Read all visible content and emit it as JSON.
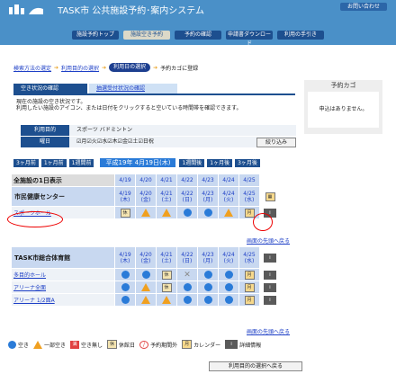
{
  "header": {
    "title": "TASK市 公共施設予約･案内システム",
    "help": "お問い合わせ",
    "nav": [
      "施設予約トップ",
      "施設空き予約",
      "予約の確認",
      "申請書ダウンロード",
      "利用の手引き"
    ],
    "active_nav": 1
  },
  "steps": {
    "s1": "検索方法の選定",
    "s2": "利用目的の選択",
    "s3": "利用日の選択",
    "s4": "予約カゴに登録"
  },
  "tabs": {
    "t1": "空き状況の確認",
    "t2": "抽選受付状況の確認"
  },
  "notice": {
    "line1": "現在の施設の空き状況です。",
    "line2": "利用したい施設のアイコン、または日付をクリックすると空いている時間帯を確認できます。"
  },
  "filter": {
    "purpose_label": "利用目的",
    "purpose_value": "スポーツ バドミントン",
    "day_label": "曜日",
    "days": [
      "月",
      "火",
      "水",
      "木",
      "金",
      "土",
      "日祝"
    ],
    "narrow_button": "絞り込み"
  },
  "side": {
    "title": "予約カゴ",
    "body": "申込はありません。"
  },
  "datenav": {
    "prev3": "3ヶ月前",
    "prev1": "1ヶ月前",
    "prevw": "1週間前",
    "current": "平成19年 4月19日(木)",
    "nextw": "1週間後",
    "next1": "1ヶ月後",
    "next3": "3ヶ月後"
  },
  "section_all": "全施設の1日表示",
  "center1": {
    "name": "市民健康センター",
    "facilities": [
      {
        "name": "スポーツホール",
        "cells": [
          "rest",
          "few",
          "few",
          "open",
          "open",
          "few",
          "cal",
          "info"
        ]
      }
    ],
    "back": "画面の先頭へ戻る"
  },
  "center2": {
    "name": "TASK市総合体育館",
    "facilities": [
      {
        "name": "多目的ホール",
        "cells": [
          "open",
          "open",
          "rest",
          "x",
          "open",
          "open",
          "cal",
          "info"
        ]
      },
      {
        "name": "アリーナ全面",
        "cells": [
          "open",
          "few",
          "rest",
          "open",
          "open",
          "open",
          "cal",
          "info"
        ]
      },
      {
        "name": "アリーナ 1/2面A",
        "cells": [
          "open",
          "few",
          "few",
          "open",
          "open",
          "open",
          "cal",
          "info"
        ]
      }
    ],
    "back": "画面の先頭へ戻る"
  },
  "dates": [
    {
      "d": "4/19",
      "w": "(木)"
    },
    {
      "d": "4/20",
      "w": "(金)"
    },
    {
      "d": "4/21",
      "w": "(土)"
    },
    {
      "d": "4/22",
      "w": "(日)"
    },
    {
      "d": "4/23",
      "w": "(月)"
    },
    {
      "d": "4/24",
      "w": "(火)"
    },
    {
      "d": "4/25",
      "w": "(水)"
    }
  ],
  "legend": {
    "open": "空き",
    "few": "一部空き",
    "close": "空き無し",
    "rest": "休館日",
    "stop": "予約期間外",
    "cal": "カレンダー",
    "info": "詳細情報"
  },
  "bottom_button": "利用目的の選択へ戻る",
  "colors": {
    "brand": "#4a90c8",
    "nav": "#1d4f8f",
    "link": "#1d3fc6",
    "open": "#2a7bd8",
    "few": "#f0a020",
    "closed": "#e04040"
  }
}
